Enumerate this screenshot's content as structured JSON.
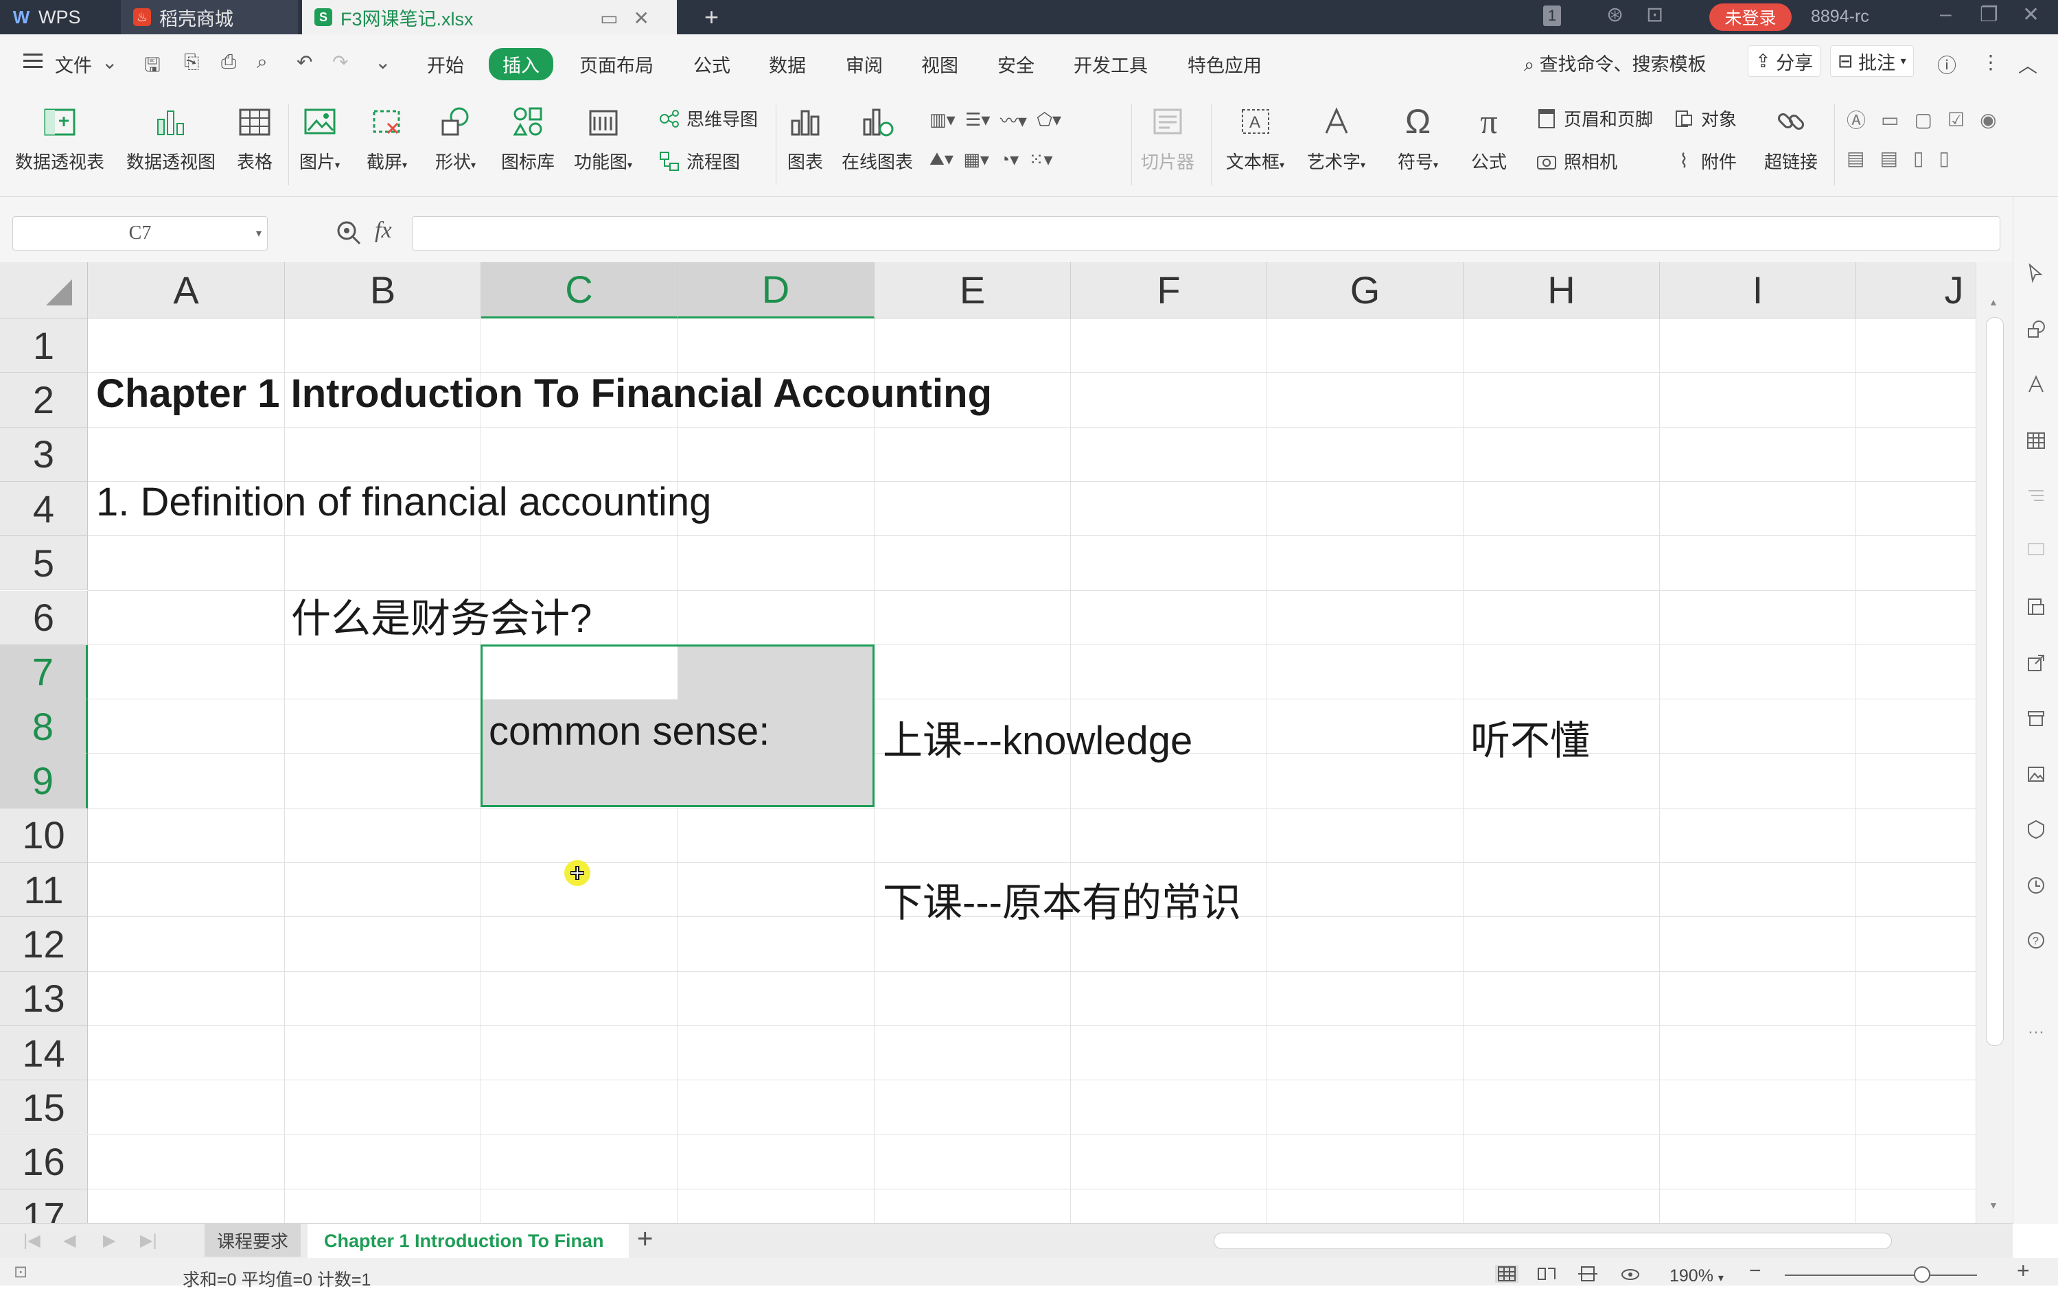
{
  "titlebar": {
    "wps_label": "WPS",
    "tab_store": "稻壳商城",
    "tab_file": "F3网课笔记.xlsx",
    "add_tab": "+",
    "page_count": "1",
    "login": "未登录",
    "user_id": "8894-rc"
  },
  "menu": {
    "file": "文件",
    "items": [
      "开始",
      "插入",
      "页面布局",
      "公式",
      "数据",
      "审阅",
      "视图",
      "安全",
      "开发工具",
      "特色应用"
    ],
    "search": "查找命令、搜索模板",
    "share": "分享",
    "comment": "批注"
  },
  "ribbon": {
    "pivot_table": "数据透视表",
    "pivot_chart": "数据透视图",
    "table": "表格",
    "picture": "图片",
    "screenshot": "截屏",
    "shape": "形状",
    "icon_lib": "图标库",
    "func_chart": "功能图",
    "mindmap": "思维导图",
    "flowchart": "流程图",
    "chart": "图表",
    "online_chart": "在线图表",
    "slicer": "切片器",
    "textbox": "文本框",
    "wordart": "艺术字",
    "symbol": "符号",
    "formula": "公式",
    "header_footer": "页眉和页脚",
    "camera": "照相机",
    "object": "对象",
    "attachment": "附件",
    "hyperlink": "超链接"
  },
  "formula_bar": {
    "cell_ref": "C7",
    "fx": "fx",
    "value": ""
  },
  "grid": {
    "columns": [
      "A",
      "B",
      "C",
      "D",
      "E",
      "F",
      "G",
      "H",
      "I",
      "J"
    ],
    "rows": [
      "1",
      "2",
      "3",
      "4",
      "5",
      "6",
      "7",
      "8",
      "9",
      "10",
      "11",
      "12",
      "13",
      "14",
      "15",
      "16",
      "17"
    ],
    "cells": {
      "A2": "Chapter 1 Introduction To Financial Accounting",
      "A4": "1. Definition of financial accounting",
      "B6": "什么是财务会计?",
      "C8": "common sense:",
      "E8": "上课---knowledge",
      "H8": "听不懂",
      "E11": "下课---原本有的常识"
    }
  },
  "sheets": {
    "tab1": "课程要求",
    "tab2": "Chapter 1 Introduction To Finan",
    "add": "+"
  },
  "status": {
    "stats": "求和=0  平均值=0  计数=1",
    "zoom": "190%"
  },
  "colors": {
    "accent": "#1e9d57",
    "titlebar": "#2c3341",
    "login": "#e54d42"
  }
}
